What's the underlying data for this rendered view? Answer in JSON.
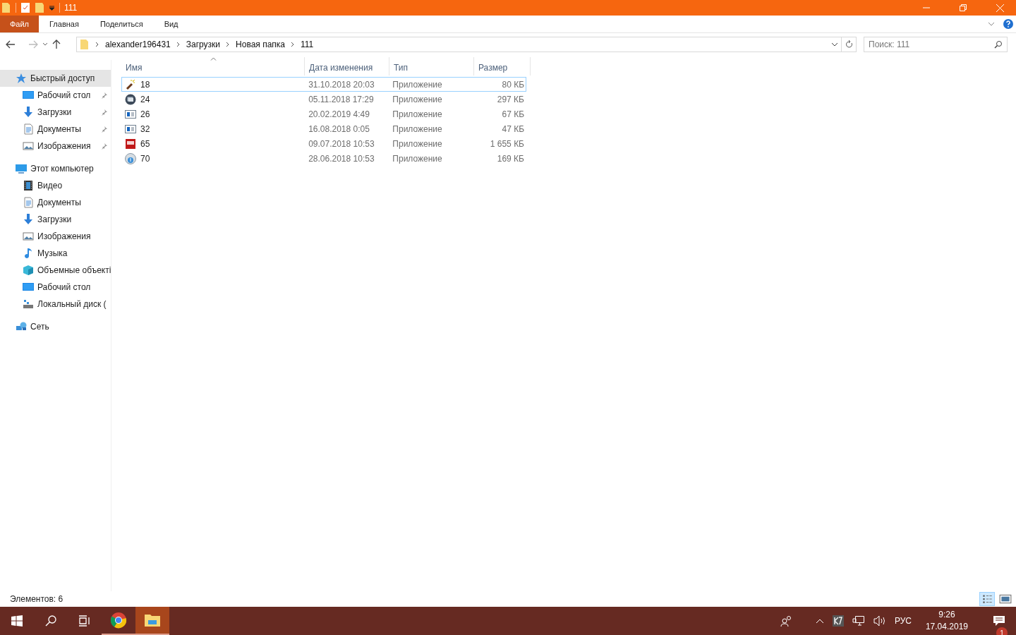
{
  "window": {
    "title": "111"
  },
  "ribbon_tabs": [
    {
      "label": "Файл",
      "kind": "file"
    },
    {
      "label": "Главная",
      "kind": "tab"
    },
    {
      "label": "Поделиться",
      "kind": "tab"
    },
    {
      "label": "Вид",
      "kind": "tab"
    }
  ],
  "address": {
    "segments": [
      "alexander196431",
      "Загрузки",
      "Новая папка",
      "111"
    ]
  },
  "search": {
    "placeholder": "Поиск: 111"
  },
  "sidebar": {
    "items": [
      {
        "label": "Быстрый доступ",
        "kind": "star",
        "selected": true,
        "children": [
          {
            "label": "Рабочий стол",
            "kind": "desktop",
            "pinned": true,
            "selected": false
          },
          {
            "label": "Загрузки",
            "kind": "download",
            "pinned": true,
            "selected": false
          },
          {
            "label": "Документы",
            "kind": "documents",
            "pinned": true,
            "selected": false
          },
          {
            "label": "Изображения",
            "kind": "pictures",
            "pinned": true,
            "selected": false
          }
        ]
      },
      {
        "label": "Этот компьютер",
        "kind": "computer",
        "selected": false,
        "children": [
          {
            "label": "Видео",
            "kind": "video",
            "pinned": false,
            "selected": false
          },
          {
            "label": "Документы",
            "kind": "documents",
            "pinned": false,
            "selected": false
          },
          {
            "label": "Загрузки",
            "kind": "download",
            "pinned": false,
            "selected": false
          },
          {
            "label": "Изображения",
            "kind": "pictures",
            "pinned": false,
            "selected": false
          },
          {
            "label": "Музыка",
            "kind": "music",
            "pinned": false,
            "selected": false
          },
          {
            "label": "Объемные объекті",
            "kind": "objects",
            "pinned": false,
            "selected": false
          },
          {
            "label": "Рабочий стол",
            "kind": "desktop",
            "pinned": false,
            "selected": false
          },
          {
            "label": "Локальный диск (",
            "kind": "disk",
            "pinned": false,
            "selected": false
          }
        ]
      },
      {
        "label": "Сеть",
        "kind": "network",
        "selected": false
      }
    ]
  },
  "table": {
    "columns": [
      {
        "label": "Имя",
        "sorted": true
      },
      {
        "label": "Дата изменения",
        "sorted": false
      },
      {
        "label": "Тип",
        "sorted": false
      },
      {
        "label": "Размер",
        "sorted": false
      }
    ],
    "rows": [
      {
        "name": "18",
        "date": "31.10.2018 20:03",
        "type": "Приложение",
        "size": "80 КБ",
        "kind": "wand",
        "focused": true
      },
      {
        "name": "24",
        "date": "05.11.2018 17:29",
        "type": "Приложение",
        "size": "297 КБ",
        "kind": "screen",
        "focused": false
      },
      {
        "name": "26",
        "date": "20.02.2019 4:49",
        "type": "Приложение",
        "size": "67 КБ",
        "kind": "window",
        "focused": false
      },
      {
        "name": "32",
        "date": "16.08.2018 0:05",
        "type": "Приложение",
        "size": "47 КБ",
        "kind": "window",
        "focused": false
      },
      {
        "name": "65",
        "date": "09.07.2018 10:53",
        "type": "Приложение",
        "size": "1 655 КБ",
        "kind": "ico",
        "focused": false
      },
      {
        "name": "70",
        "date": "28.06.2018 10:53",
        "type": "Приложение",
        "size": "169 КБ",
        "kind": "globe",
        "focused": false
      }
    ]
  },
  "status_bar": {
    "count": "Элементов: 6",
    "views": [
      {
        "kind": "details",
        "selected": true
      },
      {
        "kind": "tiles",
        "selected": false
      }
    ]
  },
  "taskbar": {
    "apps": [
      {
        "kind": "browser",
        "active": false
      },
      {
        "kind": "folder",
        "active": true
      }
    ],
    "language": "РУС",
    "time": "9:26",
    "date": "17.04.2019",
    "notifications": "1"
  }
}
